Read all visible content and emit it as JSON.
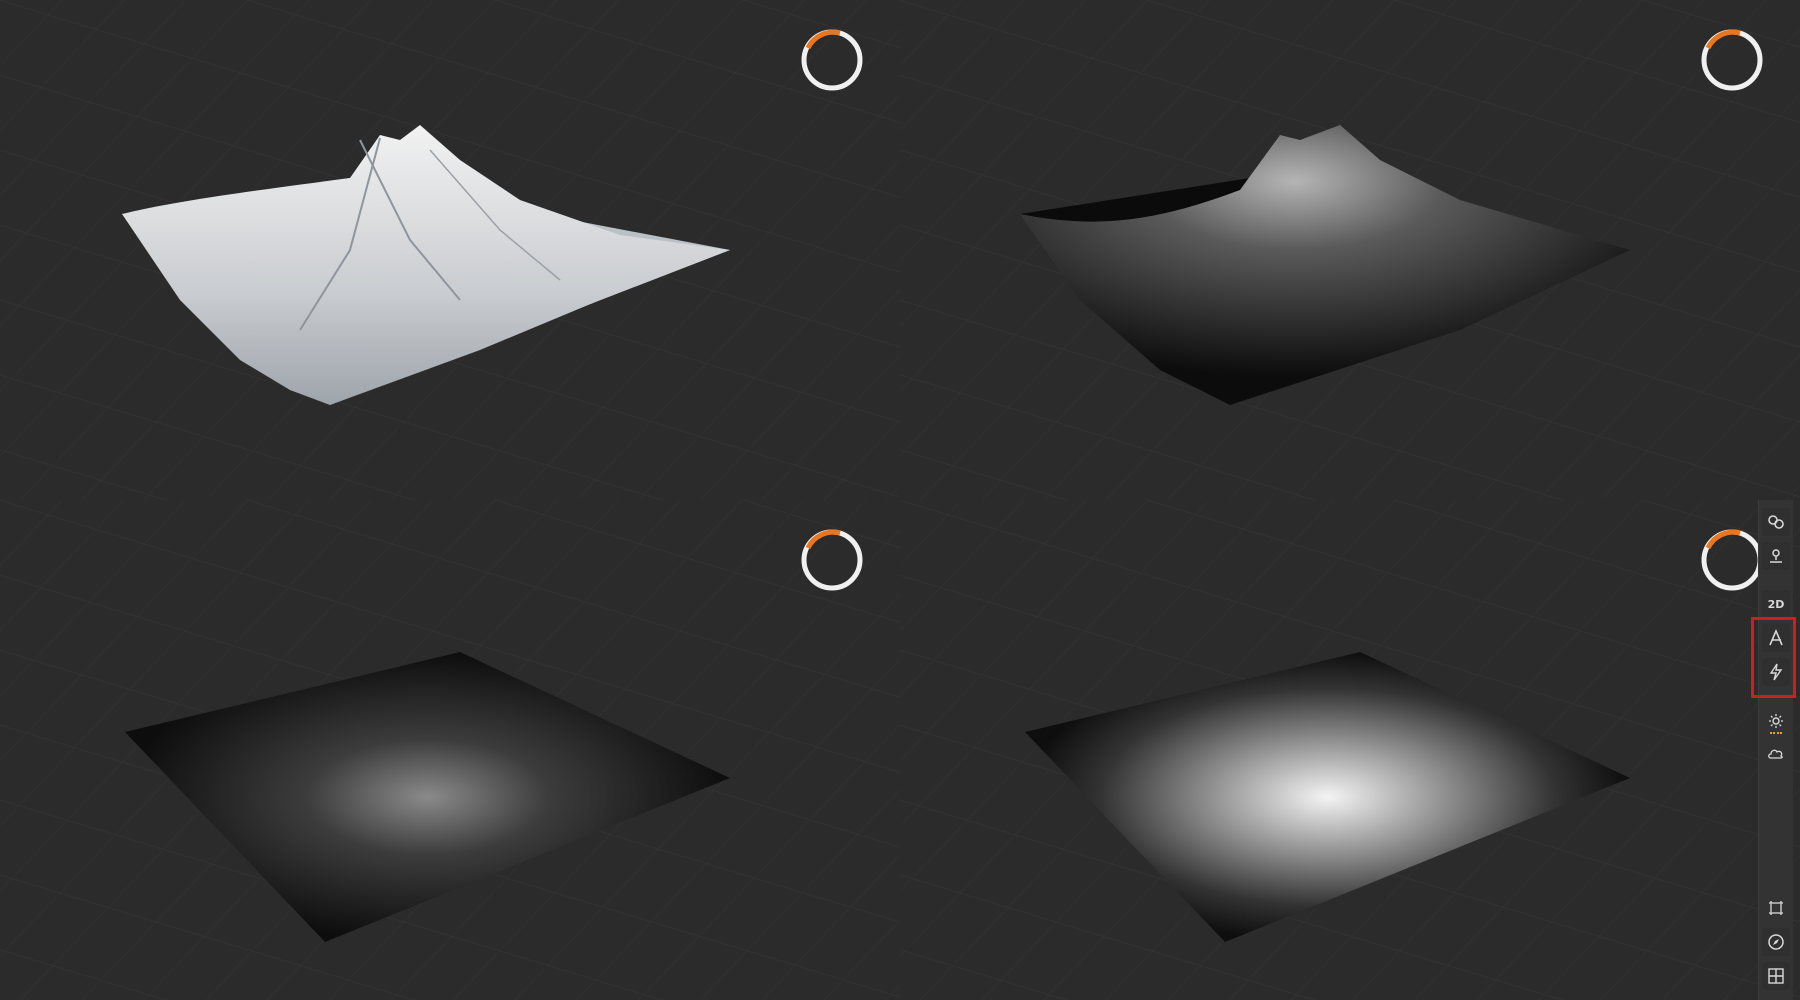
{
  "app": {
    "accent_color": "#e87722",
    "highlight_color": "#cc1f1f"
  },
  "viewports": [
    {
      "id": "top-left",
      "content": "shaded-terrain"
    },
    {
      "id": "top-right",
      "content": "dark-shaded-terrain"
    },
    {
      "id": "bottom-left",
      "content": "heightmap-plane-dim"
    },
    {
      "id": "bottom-right",
      "content": "heightmap-plane-bright"
    }
  ],
  "toolbar": {
    "items": [
      {
        "name": "link-icon"
      },
      {
        "name": "pin-icon"
      },
      {
        "name": "view-2d-button",
        "label": "2D"
      },
      {
        "name": "text-a-icon"
      },
      {
        "name": "lightning-icon"
      },
      {
        "name": "sun-icon"
      },
      {
        "name": "cloud-icon"
      },
      {
        "name": "frame-icon"
      },
      {
        "name": "compass-icon"
      },
      {
        "name": "grid-icon"
      }
    ],
    "view_2d_label": "2D"
  }
}
